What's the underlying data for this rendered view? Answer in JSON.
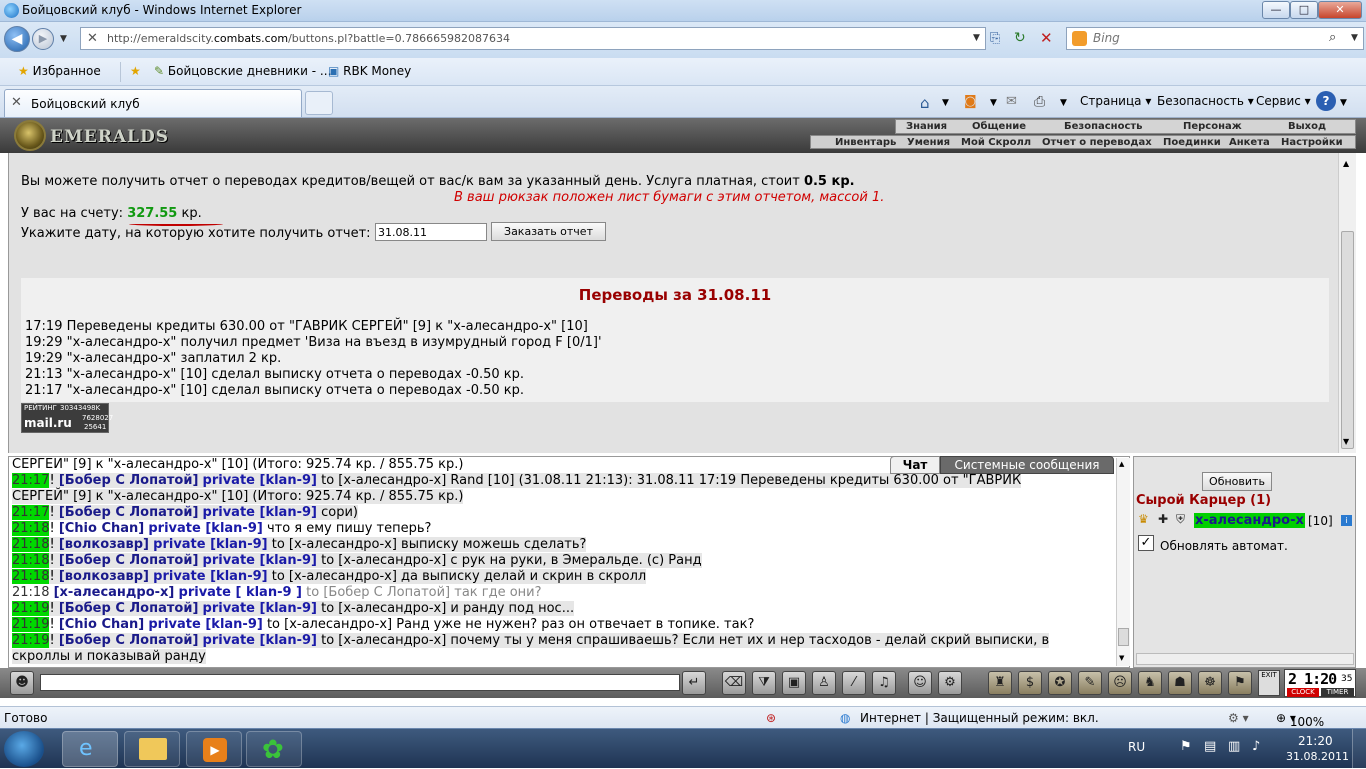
{
  "window": {
    "title": "Бойцовский клуб - Windows Internet Explorer",
    "min_glyph": "—",
    "max_glyph": "□",
    "close_glyph": "✕"
  },
  "addressbar": {
    "url_prefix": "http://emeraldscity.",
    "url_domain": "combats.com",
    "url_rest": "/buttons.pl?battle=0.786665982087634",
    "search_placeholder": "Bing"
  },
  "favorites": {
    "label": "Избранное",
    "items": [
      "Бойцовские дневники - ...",
      "RBK Money"
    ]
  },
  "tab": {
    "title": "Бойцовский клуб"
  },
  "commandbar": {
    "page": "Страница",
    "safety": "Безопасность",
    "service": "Сервис",
    "help": "?"
  },
  "game": {
    "logo": "EMERALDS",
    "menu_top": [
      "Знания",
      "Общение",
      "Безопасность",
      "Персонаж",
      "Выход"
    ],
    "menu_bottom": [
      "Инвентарь",
      "Умения",
      "Мой Скролл",
      "Отчет о переводах",
      "Поединки",
      "Анкета",
      "Настройки"
    ]
  },
  "report": {
    "intro": "Вы можете получить отчет о переводах кредитов/вещей от вас/к вам за указанный день. Услуга платная, стоит",
    "price": "0.5 кр.",
    "notice": "В ваш рюкзак положен лист бумаги с этим отчетом, массой 1.",
    "balance_label": "У вас на счету:",
    "balance_value": "327.55",
    "balance_unit": "кр.",
    "date_prompt": "Укажите дату, на которую хотите получить отчет:",
    "date_value": "31.08.11",
    "order_button": "Заказать отчет",
    "title": "Переводы за 31.08.11",
    "lines": [
      "17:19 Переведены кредиты 630.00 от \"ГАВРИК СЕРГЕЙ\" [9] к \"х-алесандро-х\" [10]",
      "19:29 \"х-алесандро-х\" получил предмет 'Виза на въезд в изумрудный город F [0/1]'",
      "19:29 \"х-алесандро-х\" заплатил 2 кр.",
      "21:13 \"х-алесандро-х\" [10] сделал выписку отчета о переводах -0.50 кр.",
      "21:17 \"х-алесандро-х\" [10] сделал выписку отчета о переводах -0.50 кр."
    ],
    "rating_label": "РЕЙТИНГ",
    "rating_n1": "30343498K",
    "rating_n2": "7628027",
    "rating_n3": "25641",
    "rating_brand": "mail.ru"
  },
  "chat": {
    "tab_chat": "Чат",
    "tab_system": "Системные сообщения",
    "lines": [
      {
        "ts": "",
        "name": "",
        "priv": "",
        "text": "СЕРГЕЙ\" [9] к \"х-алесандро-х\" [10] (Итого: 925.74 кр. / 855.75 кр.)",
        "hl": false
      },
      {
        "ts": "21:17",
        "name": "[Бобер С Лопатой]",
        "priv": "private [klan-9]",
        "text": "to [х-алесандро-х] Rand [10] (31.08.11 21:13): 31.08.11 17:19 Переведены кредиты 630.00 от \"ГАВРИК",
        "hl": true
      },
      {
        "ts": "",
        "name": "",
        "priv": "",
        "text": "СЕРГЕЙ\" [9] к \"х-алесандро-х\" [10] (Итого: 925.74 кр. / 855.75 кр.)",
        "hl": true
      },
      {
        "ts": "21:17",
        "name": "[Бобер С Лопатой]",
        "priv": "private [klan-9]",
        "text": "сори)",
        "hl": true
      },
      {
        "ts": "21:18",
        "name": "[Chio Chan]",
        "priv": "private [klan-9]",
        "text": "что я ему пишу теперь?",
        "hl": false
      },
      {
        "ts": "21:18",
        "name": "[волкозавр]",
        "priv": "private [klan-9]",
        "text": "to [х-алесандро-х] выписку можешь сделать?",
        "hl": true
      },
      {
        "ts": "21:18",
        "name": "[Бобер С Лопатой]",
        "priv": "private [klan-9]",
        "text": "to [х-алесандро-х] с рук на руки, в Эмеральде. (c) Ранд",
        "hl": true
      },
      {
        "ts": "21:18",
        "name": "[волкозавр]",
        "priv": "private [klan-9]",
        "text": "to [х-алесандро-х] да выписку делай и скрин в скролл",
        "hl": true
      },
      {
        "ts": "21:18",
        "name": "[х-алесандро-х]",
        "priv": "private [ klan-9 ]",
        "text": "to [Бобер С Лопатой] так где они?",
        "hl": false,
        "self": true
      },
      {
        "ts": "21:19",
        "name": "[Бобер С Лопатой]",
        "priv": "private [klan-9]",
        "text": "to [х-алесандро-х] и ранду под нос...",
        "hl": true
      },
      {
        "ts": "21:19",
        "name": "[Chio Chan]",
        "priv": "private [klan-9]",
        "text": "to [х-алесандро-х] Ранд уже не нужен? раз он отвечает в топике. так?",
        "hl": false
      },
      {
        "ts": "21:19",
        "name": "[Бобер С Лопатой]",
        "priv": "private [klan-9]",
        "text": "to [х-алесандро-х] почему ты у меня спрашиваешь? Если нет их и нер тасходов - делай скрий выписки, в",
        "hl": true
      },
      {
        "ts": "",
        "name": "",
        "priv": "",
        "text": "скроллы и показывай ранду",
        "hl": true
      }
    ]
  },
  "room": {
    "refresh_button": "Обновить",
    "name": "Сырой Карцер (1)",
    "player": "х-алесандро-х",
    "player_level": "[10]",
    "auto_refresh_label": "Обновлять автомат."
  },
  "clock": {
    "time": "2 1:20",
    "seconds": "35",
    "exit": "EXIT",
    "clock_label": "CLOCK",
    "timer_label": "TIMER"
  },
  "status": {
    "ready": "Готово",
    "zone": "Интернет | Защищенный режим: вкл.",
    "zoom": "100%"
  },
  "taskbar": {
    "lang": "RU",
    "time": "21:20",
    "date": "31.08.2011"
  }
}
